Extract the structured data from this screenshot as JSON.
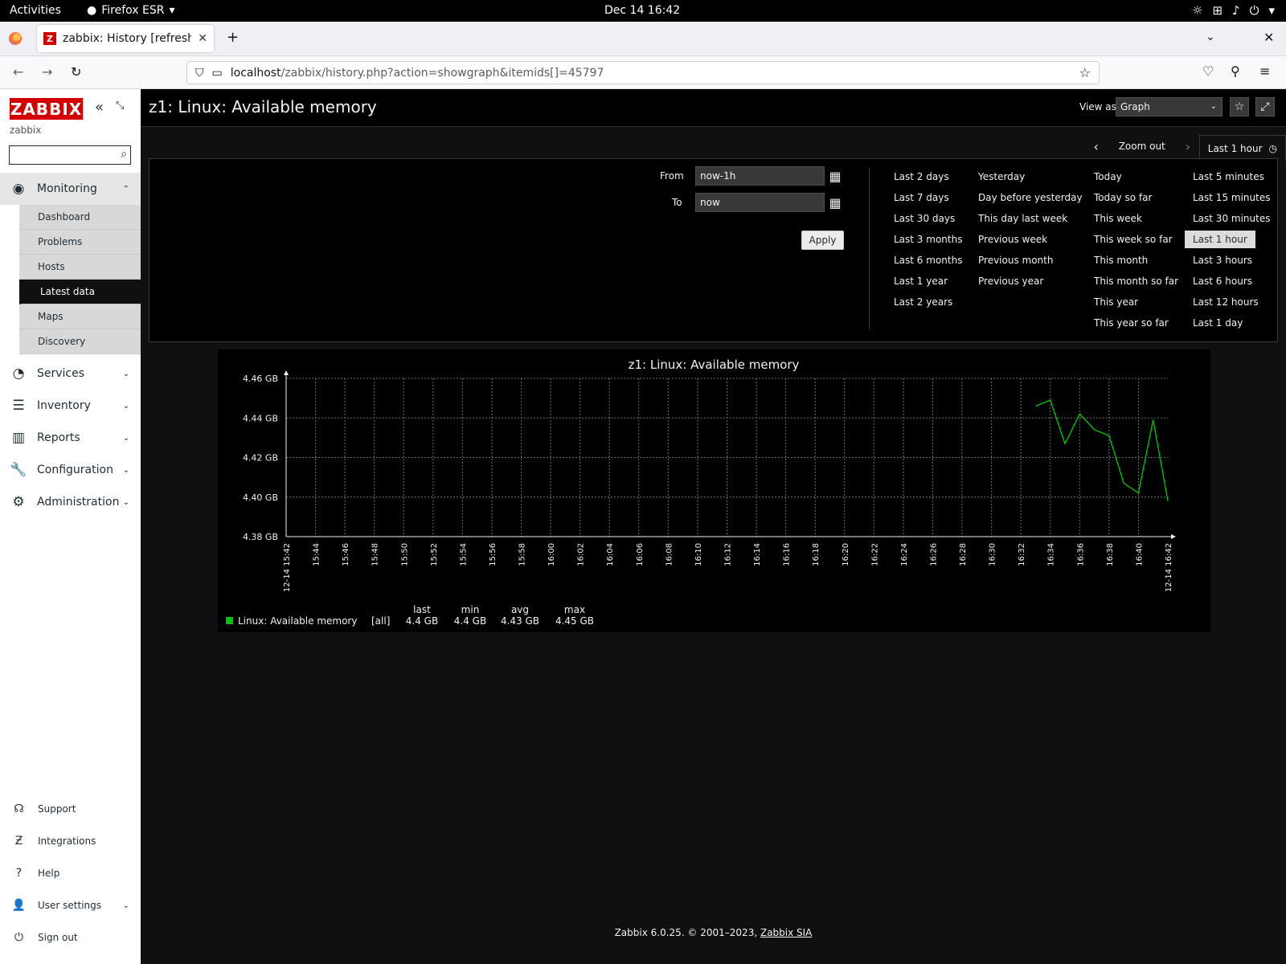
{
  "os": {
    "activities": "Activities",
    "app_name": "Firefox ESR",
    "clock": "Dec 14  16:42"
  },
  "browser": {
    "tab_title": "zabbix: History [refreshed",
    "url_host": "localhost",
    "url_path": "/zabbix/history.php?action=showgraph&itemids[]=45797"
  },
  "sidebar": {
    "logo": "ZABBIX",
    "server_name": "zabbix",
    "search_placeholder": "",
    "monitoring": {
      "label": "Monitoring",
      "items": [
        "Dashboard",
        "Problems",
        "Hosts",
        "Latest data",
        "Maps",
        "Discovery"
      ],
      "selected": "Latest data"
    },
    "sections": [
      "Services",
      "Inventory",
      "Reports",
      "Configuration",
      "Administration"
    ],
    "footer": [
      "Support",
      "Integrations",
      "Help",
      "User settings",
      "Sign out"
    ]
  },
  "header": {
    "title": "z1: Linux: Available memory",
    "view_as_label": "View as",
    "view_as_value": "Graph"
  },
  "filter": {
    "zoom_out": "Zoom out",
    "active_tab": "Last 1 hour",
    "from_label": "From",
    "from_value": "now-1h",
    "to_label": "To",
    "to_value": "now",
    "apply": "Apply",
    "quick_col1": [
      "Last 2 days",
      "Last 7 days",
      "Last 30 days",
      "Last 3 months",
      "Last 6 months",
      "Last 1 year",
      "Last 2 years"
    ],
    "quick_col2": [
      "Yesterday",
      "Day before yesterday",
      "This day last week",
      "Previous week",
      "Previous month",
      "Previous year"
    ],
    "quick_col3": [
      "Today",
      "Today so far",
      "This week",
      "This week so far",
      "This month",
      "This month so far",
      "This year",
      "This year so far"
    ],
    "quick_col4": [
      "Last 5 minutes",
      "Last 15 minutes",
      "Last 30 minutes",
      "Last 1 hour",
      "Last 3 hours",
      "Last 6 hours",
      "Last 12 hours",
      "Last 1 day"
    ],
    "quick_selected": "Last 1 hour"
  },
  "chart_data": {
    "type": "line",
    "title": "z1: Linux: Available memory",
    "y_ticks": [
      "4.46 GB",
      "4.44 GB",
      "4.42 GB",
      "4.40 GB",
      "4.38 GB"
    ],
    "ylim": [
      4.38,
      4.46
    ],
    "x_ticks": [
      "12-14 15:42",
      "15:44",
      "15:46",
      "15:48",
      "15:50",
      "15:52",
      "15:54",
      "15:56",
      "15:58",
      "16:00",
      "16:02",
      "16:04",
      "16:06",
      "16:08",
      "16:10",
      "16:12",
      "16:14",
      "16:16",
      "16:18",
      "16:20",
      "16:22",
      "16:24",
      "16:26",
      "16:28",
      "16:30",
      "16:32",
      "16:34",
      "16:36",
      "16:38",
      "16:40",
      "12-14 16:42"
    ],
    "series": [
      {
        "name": "Linux: Available memory",
        "color": "#00c800",
        "x": [
          "16:33",
          "16:34",
          "16:35",
          "16:36",
          "16:37",
          "16:38",
          "16:39",
          "16:40",
          "16:41",
          "16:42"
        ],
        "values": [
          4.446,
          4.449,
          4.427,
          4.442,
          4.434,
          4.431,
          4.407,
          4.402,
          4.439,
          4.398
        ]
      }
    ],
    "legend": {
      "name": "Linux: Available memory",
      "func": "[all]",
      "headers": [
        "last",
        "min",
        "avg",
        "max"
      ],
      "values": [
        "4.4 GB",
        "4.4 GB",
        "4.43 GB",
        "4.45 GB"
      ]
    }
  },
  "footer": {
    "text": "Zabbix 6.0.25. © 2001–2023,",
    "link": "Zabbix SIA"
  }
}
